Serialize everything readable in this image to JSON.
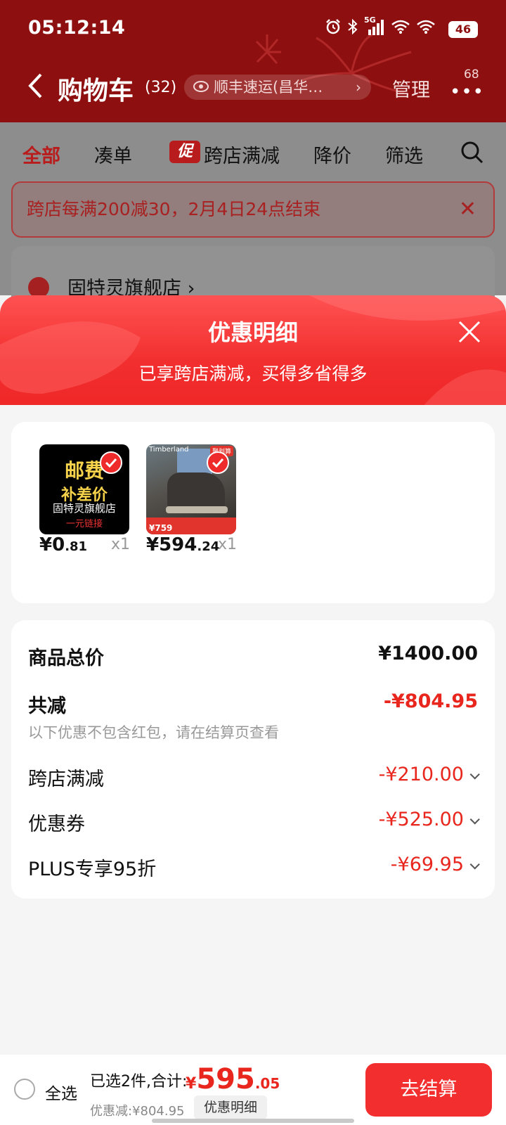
{
  "status_bar": {
    "time": "05:12:14",
    "network": "5G",
    "battery": "46",
    "icons": [
      "alarm-icon",
      "bluetooth-icon",
      "cellular-signal-icon",
      "wifi-icon",
      "wifi-icon",
      "battery-icon"
    ]
  },
  "header": {
    "title": "购物车",
    "count": "(32)",
    "address": "顺丰速运(昌华…",
    "manage": "管理",
    "more_badge": "68"
  },
  "tabs": [
    {
      "label": "全部",
      "active": true
    },
    {
      "label": "凑单"
    },
    {
      "label": "跨店满减",
      "tag": "促"
    },
    {
      "label": "降价"
    },
    {
      "label": "筛选"
    }
  ],
  "promo_banner": {
    "text": "跨店每满200减30，2月4日24点结束"
  },
  "store": {
    "name": "固特灵旗舰店 ›"
  },
  "sheet": {
    "title": "优惠明细",
    "subtitle": "已享跨店满减，买得多省得多",
    "products": [
      {
        "thumb_line1": "邮费",
        "thumb_line2": "补差价",
        "thumb_line3": "固特灵旗舰店",
        "thumb_line4": "一元链接",
        "price_int": "¥0",
        "price_dec": ".81",
        "qty": "x1"
      },
      {
        "thumb_logo": "Timberland",
        "thumb_badge": "聚划算",
        "thumb_price": "¥759",
        "price_int": "¥594",
        "price_dec": ".24",
        "qty": "x1"
      }
    ],
    "summary": {
      "total_label": "商品总价",
      "total_value": "¥1400.00",
      "discount_label": "共减",
      "discount_value": "-¥804.95",
      "note": "以下优惠不包含红包，请在结算页查看",
      "items": [
        {
          "label": "跨店满减",
          "value": "-¥210.00"
        },
        {
          "label": "优惠券",
          "value": "-¥525.00"
        },
        {
          "label": "PLUS专享95折",
          "value": "-¥69.95"
        }
      ]
    }
  },
  "bottom_bar": {
    "select_all": "全选",
    "selected": "已选2件,合计:",
    "currency": "¥",
    "total_int": "595",
    "total_dec": ".05",
    "saved": "优惠减:¥804.95",
    "detail_button": "优惠明细",
    "checkout": "去结算"
  },
  "colors": {
    "header_bg": "#8e0f0f",
    "accent_red": "#e8261d",
    "checkout_bg": "#f32e2e"
  }
}
